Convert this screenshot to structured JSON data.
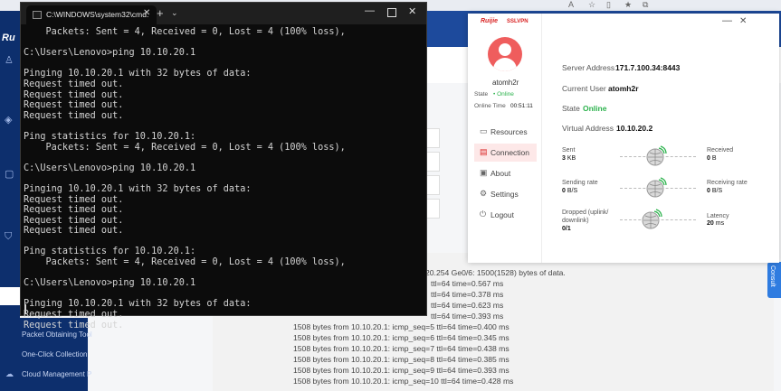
{
  "cmd": {
    "tab_title": "C:\\WINDOWS\\system32\\cmd.",
    "tab_close": "✕",
    "add": "+",
    "dropdown": "⌄",
    "min": "—",
    "close": "✕",
    "lines": [
      "    Packets: Sent = 4, Received = 0, Lost = 4 (100% loss),",
      "",
      "C:\\Users\\Lenovo>ping 10.10.20.1",
      "",
      "Pinging 10.10.20.1 with 32 bytes of data:",
      "Request timed out.",
      "Request timed out.",
      "Request timed out.",
      "Request timed out.",
      "",
      "Ping statistics for 10.10.20.1:",
      "    Packets: Sent = 4, Received = 0, Lost = 4 (100% loss),",
      "",
      "C:\\Users\\Lenovo>ping 10.10.20.1",
      "",
      "Pinging 10.10.20.1 with 32 bytes of data:",
      "Request timed out.",
      "Request timed out.",
      "Request timed out.",
      "Request timed out.",
      "",
      "Ping statistics for 10.10.20.1:",
      "    Packets: Sent = 4, Received = 0, Lost = 4 (100% loss),",
      "",
      "C:\\Users\\Lenovo>ping 10.10.20.1",
      "",
      "Pinging 10.10.20.1 with 32 bytes of data:",
      "Request timed out.",
      "Request timed out."
    ]
  },
  "background": {
    "logo": "Ru",
    "menu": [
      "Packet Obtaining Tool",
      "One-Click Collection",
      "Cloud Management P"
    ],
    "consult": "Consult",
    "ping_header": "20.254 Ge0/6: 1500(1528) bytes of data.",
    "ping_lines": [
      {
        "prefix": "",
        "text": "ttl=64 time=0.567 ms"
      },
      {
        "prefix": "",
        "text": "ttl=64 time=0.378 ms"
      },
      {
        "prefix": "",
        "text": "ttl=64 time=0.623 ms"
      },
      {
        "prefix": "",
        "text": "ttl=64 time=0.393 ms"
      },
      {
        "prefix": "1508 bytes from 10.10.20.1: icmp_seq=5 ",
        "text": "ttl=64 time=0.400 ms"
      },
      {
        "prefix": "1508 bytes from 10.10.20.1: icmp_seq=6 ",
        "text": "ttl=64 time=0.345 ms"
      },
      {
        "prefix": "1508 bytes from 10.10.20.1: icmp_seq=7 ",
        "text": "ttl=64 time=0.438 ms"
      },
      {
        "prefix": "1508 bytes from 10.10.20.1: icmp_seq=8 ",
        "text": "ttl=64 time=0.385 ms"
      },
      {
        "prefix": "1508 bytes from 10.10.20.1: icmp_seq=9 ",
        "text": "ttl=64 time=0.393 ms"
      },
      {
        "prefix": "1508 bytes from 10.10.20.1: icmp_seq=10 ",
        "text": "ttl=64 time=0.428 ms"
      }
    ]
  },
  "vpn": {
    "brand": "Ruijie",
    "product": "SSLVPN",
    "min": "—",
    "close": "✕",
    "username": "atomh2r",
    "state_label": "State",
    "state_value": "• Online",
    "online_time_label": "Online Time",
    "online_time_value": "00:51:11",
    "nav": [
      {
        "label": "Resources",
        "icon": "▭"
      },
      {
        "label": "Connection",
        "icon": "▤"
      },
      {
        "label": "About",
        "icon": "▣"
      },
      {
        "label": "Settings",
        "icon": "⚙"
      },
      {
        "label": "Logout",
        "icon": "⏻"
      }
    ],
    "server_address_label": "Server Address",
    "server_address_value": "171.7.100.34:8443",
    "current_user_label": "Current User",
    "current_user_value": "atomh2r",
    "state2_label": "State",
    "state2_value": "Online",
    "virtual_address_label": "Virtual Address",
    "virtual_address_value": "10.10.20.2",
    "stats": {
      "sent_label": "Sent",
      "sent_value": "3",
      "sent_unit": "KB",
      "received_label": "Received",
      "received_value": "0",
      "received_unit": "B",
      "sending_rate_label": "Sending rate",
      "sending_rate_value": "0",
      "sending_rate_unit": "B/S",
      "receiving_rate_label": "Receiving rate",
      "receiving_rate_value": "0",
      "receiving_rate_unit": "B/S",
      "dropped_label_1": "Dropped (uplink/",
      "dropped_label_2": "downlink)",
      "dropped_value": "0/1",
      "latency_label": "Latency",
      "latency_value": "20",
      "latency_unit": "ms"
    },
    "colors": {
      "brand": "#d92323",
      "online": "#2bb24c",
      "avatar": "#ef5d5d"
    }
  }
}
